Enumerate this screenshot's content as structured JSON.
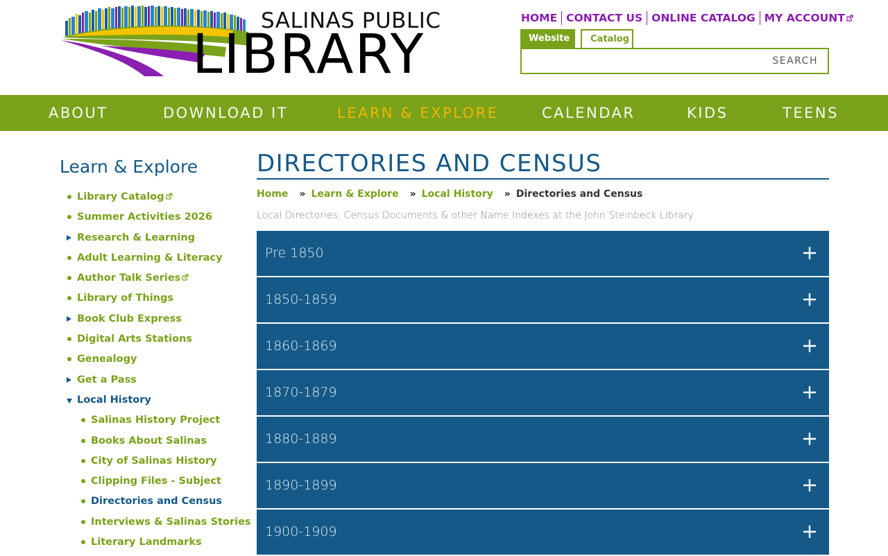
{
  "logo": {
    "top_text": "SALINAS PUBLIC",
    "big_text": "LIBRARY",
    "colors": {
      "purple": "#8a1fb0",
      "green": "#7aa21a",
      "yellow": "#f5c400"
    }
  },
  "utility_links": [
    {
      "label": "HOME",
      "external": false
    },
    {
      "label": "CONTACT US",
      "external": false
    },
    {
      "label": "ONLINE CATALOG",
      "external": false
    },
    {
      "label": "MY ACCOUNT",
      "external": true
    }
  ],
  "search": {
    "tabs": [
      "Website",
      "Catalog"
    ],
    "active_tab": "Website",
    "value": "",
    "placeholder": "",
    "button_label": "SEARCH"
  },
  "main_nav": {
    "items": [
      "ABOUT",
      "DOWNLOAD IT",
      "LEARN & EXPLORE",
      "CALENDAR",
      "KIDS",
      "TEENS"
    ],
    "current": "LEARN & EXPLORE"
  },
  "sidebar": {
    "title": "Learn & Explore",
    "items": [
      {
        "label": "Library Catalog",
        "marker": "bullet",
        "external": true
      },
      {
        "label": "Summer Activities 2026",
        "marker": "bullet"
      },
      {
        "label": "Research & Learning",
        "marker": "triangle-right"
      },
      {
        "label": "Adult Learning & Literacy",
        "marker": "bullet"
      },
      {
        "label": "Author Talk Series",
        "marker": "bullet",
        "external": true
      },
      {
        "label": "Library of Things",
        "marker": "bullet"
      },
      {
        "label": "Book Club Express",
        "marker": "triangle-right"
      },
      {
        "label": "Digital Arts Stations",
        "marker": "bullet"
      },
      {
        "label": "Genealogy",
        "marker": "bullet"
      },
      {
        "label": "Get a Pass",
        "marker": "triangle-right"
      },
      {
        "label": "Local History",
        "marker": "triangle-down",
        "active": true
      },
      {
        "label": "Salinas History Project",
        "marker": "bullet",
        "sub": true
      },
      {
        "label": "Books About Salinas",
        "marker": "bullet",
        "sub": true
      },
      {
        "label": "City of Salinas History",
        "marker": "bullet",
        "sub": true
      },
      {
        "label": "Clipping Files - Subject",
        "marker": "bullet",
        "sub": true
      },
      {
        "label": "Directories and Census",
        "marker": "bullet",
        "sub": true,
        "active": true
      },
      {
        "label": "Interviews & Salinas Stories",
        "marker": "bullet",
        "sub": true
      },
      {
        "label": "Literary Landmarks",
        "marker": "bullet",
        "sub": true
      }
    ]
  },
  "page": {
    "title": "DIRECTORIES AND CENSUS",
    "breadcrumb": [
      "Home",
      "Learn & Explore",
      "Local History",
      "Directories and Census"
    ],
    "breadcrumb_separator": "»",
    "subtitle": "Local Directories, Census Documents & other Name Indexes at the John Steinbeck Library"
  },
  "accordion": {
    "items": [
      "Pre 1850",
      "1850-1859",
      "1860-1869",
      "1870-1879",
      "1880-1889",
      "1890-1899",
      "1900-1909"
    ],
    "icon": "plus-icon"
  },
  "colors": {
    "brand_green": "#7aa21a",
    "brand_blue": "#145987",
    "brand_purple": "#8a1fb0",
    "nav_current": "#f5b800"
  }
}
